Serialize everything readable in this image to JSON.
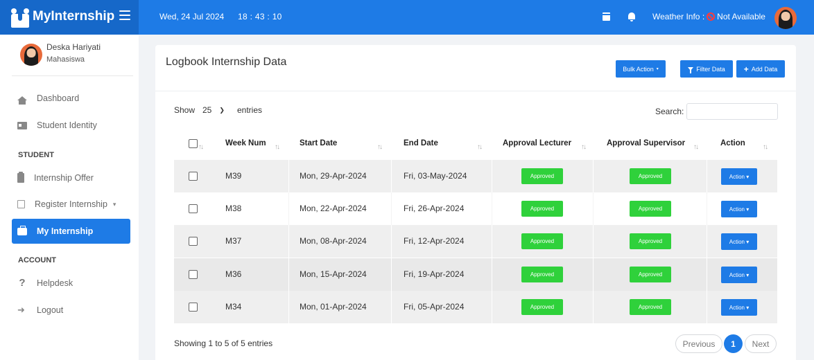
{
  "topbar": {
    "brand": "MyInternship",
    "date": "Wed, 24 Jul 2024",
    "time": "18 : 43 : 10",
    "weather_label": "Weather Info :",
    "weather_value": "Not Available",
    "icons": [
      "calendar-icon",
      "bell-icon",
      "ban-icon",
      "user-avatar"
    ]
  },
  "sidebar": {
    "user_name": "Deska Hariyati",
    "user_role": "Mahasiswa",
    "items": [
      {
        "label": "Dashboard",
        "icon": "home-icon"
      },
      {
        "label": "Student Identity",
        "icon": "id-card-icon"
      }
    ],
    "section_student": "STUDENT",
    "student_items": [
      {
        "label": "Internship Offer",
        "icon": "clipboard-icon"
      },
      {
        "label": "Register Internship",
        "icon": "calendar-icon",
        "has_submenu": true
      },
      {
        "label": "My Internship",
        "icon": "briefcase-icon",
        "active": true
      }
    ],
    "section_account": "ACCOUNT",
    "account_items": [
      {
        "label": "Helpdesk",
        "icon": "question-icon"
      },
      {
        "label": "Logout",
        "icon": "sign-out-icon"
      }
    ]
  },
  "card": {
    "title": "Logbook Internship Data",
    "bulk_action": "Bulk Action",
    "filter_data": "Filter Data",
    "add_data": "Add Data",
    "show_label": "Show",
    "page_length": "25",
    "entries_label": "entries",
    "search_label": "Search:",
    "search_value": "",
    "columns": [
      "Week Num",
      "Start Date",
      "End Date",
      "Approval Lecturer",
      "Approval Supervisor",
      "Action"
    ],
    "rows": [
      {
        "week": "M39",
        "start": "Mon, 29-Apr-2024",
        "end": "Fri, 03-May-2024",
        "lecturer": "Approved",
        "supervisor": "Approved",
        "action": "Action"
      },
      {
        "week": "M38",
        "start": "Mon, 22-Apr-2024",
        "end": "Fri, 26-Apr-2024",
        "lecturer": "Approved",
        "supervisor": "Approved",
        "action": "Action"
      },
      {
        "week": "M37",
        "start": "Mon, 08-Apr-2024",
        "end": "Fri, 12-Apr-2024",
        "lecturer": "Approved",
        "supervisor": "Approved",
        "action": "Action"
      },
      {
        "week": "M36",
        "start": "Mon, 15-Apr-2024",
        "end": "Fri, 19-Apr-2024",
        "lecturer": "Approved",
        "supervisor": "Approved",
        "action": "Action"
      },
      {
        "week": "M34",
        "start": "Mon, 01-Apr-2024",
        "end": "Fri, 05-Apr-2024",
        "lecturer": "Approved",
        "supervisor": "Approved",
        "action": "Action"
      }
    ],
    "info": "Showing 1 to 5 of 5 entries",
    "prev": "Previous",
    "page": "1",
    "next": "Next"
  },
  "colors": {
    "primary": "#1e7be6",
    "brand_dark": "#1668c9",
    "approved": "#2fd13b",
    "danger": "#ff3b3b"
  }
}
